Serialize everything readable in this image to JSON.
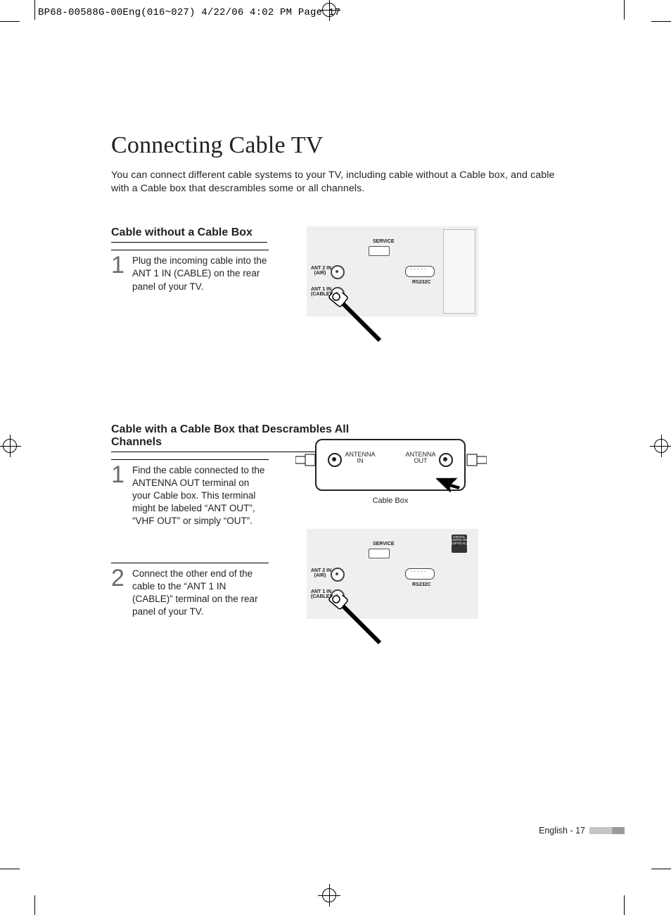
{
  "header": {
    "slug": "BP68-00588G-00Eng(016~027)  4/22/06  4:02 PM  Page 17"
  },
  "title": "Connecting Cable TV",
  "intro": "You can connect different cable systems to your TV, including cable without a Cable box, and cable with a Cable box that descrambles some or all channels.",
  "section1": {
    "heading": "Cable without a Cable Box",
    "steps": [
      {
        "num": "1",
        "text": "Plug the incoming cable into the ANT 1 IN (CABLE) on the rear panel of your TV."
      }
    ]
  },
  "section2": {
    "heading": "Cable with a Cable Box that Descrambles All Channels",
    "steps": [
      {
        "num": "1",
        "text": "Find the cable connected to the ANTENNA OUT terminal on your Cable box. This terminal might be labeled “ANT OUT”, “VHF OUT” or simply “OUT”."
      },
      {
        "num": "2",
        "text": "Connect the other end of the cable to the “ANT 1 IN (CABLE)” terminal on the rear panel of your TV."
      }
    ],
    "cablebox": {
      "label": "Cable Box",
      "port_in": "ANTENNA\nIN",
      "port_out": "ANTENNA\nOUT"
    }
  },
  "diagram_labels": {
    "service": "SERVICE",
    "ant2": "ANT 2 IN\n(AIR)",
    "ant1": "ANT 1 IN\n(CABLE)",
    "rs232": "RS232C",
    "optical": "DIGITAL\nAUDIO OUT\n(OPTICAL)"
  },
  "footer": {
    "text": "English - 17"
  }
}
